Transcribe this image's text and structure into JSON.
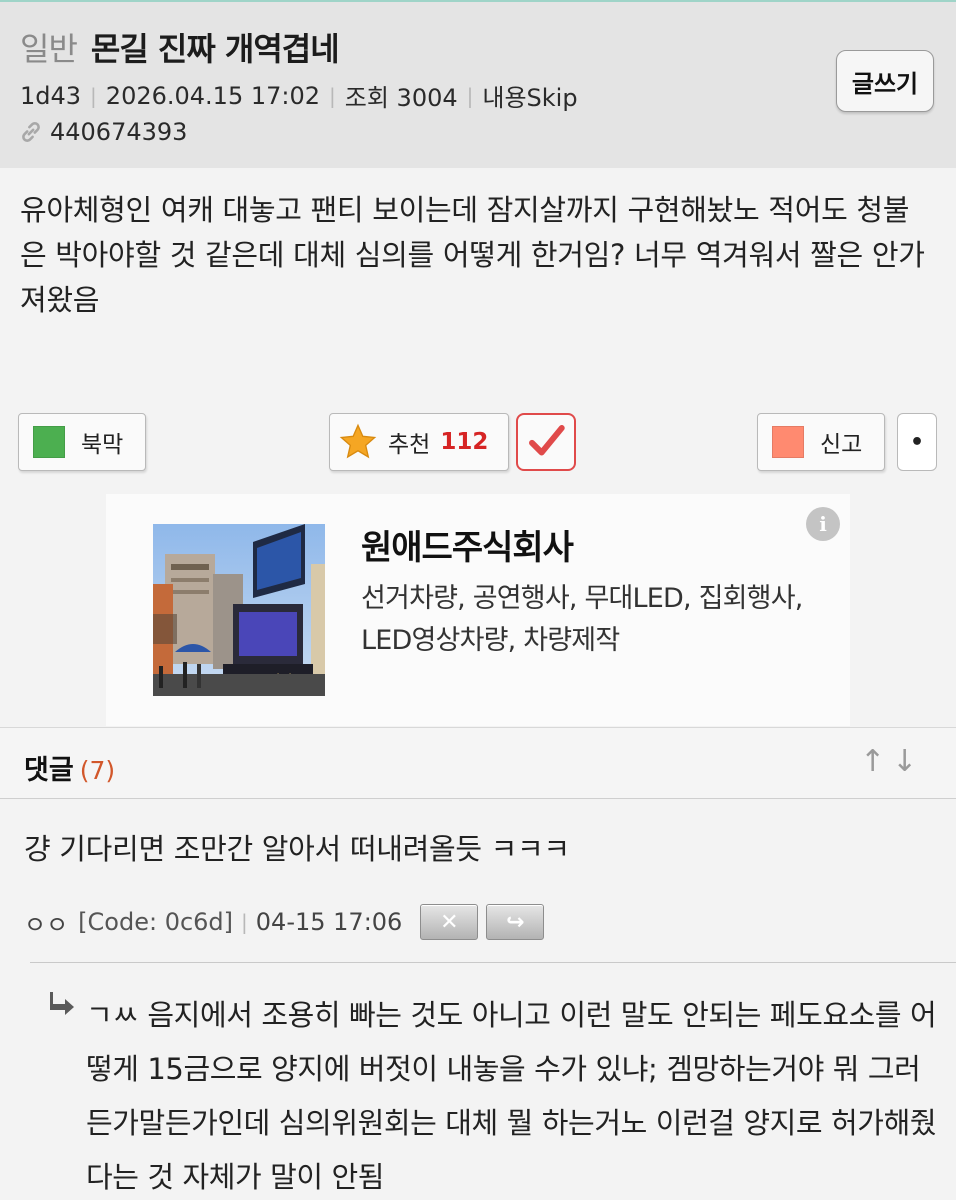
{
  "post": {
    "category": "일반",
    "title": "몬길 진짜 개역겹네",
    "author": "1d43",
    "datetime": "2026.04.15 17:02",
    "views": "조회 3004",
    "skip": "내용Skip",
    "post_number": "440674393",
    "write_button": "글쓰기",
    "body": "유아체형인 여캐 대놓고 팬티 보이는데 잠지살까지 구현해놨노 적어도 청불은 박아야할 것 같은데 대체 심의를 어떻게 한거임? 너무 역겨워서 짤은 안가져왔음"
  },
  "actions": {
    "bookmark_label": "북막",
    "recommend_label": "추천",
    "recommend_count": "112",
    "report_label": "신고",
    "more_label": "•",
    "colors": {
      "bookmark": "#4caf50",
      "report": "#ff8a70",
      "star": "#f5a623",
      "check": "#e04a4a"
    }
  },
  "ad": {
    "name": "원애드주식회사",
    "description": "선거차량, 공연행사, 무대LED, 집회행사, LED영상차량, 차량제작",
    "info_icon": "info-icon"
  },
  "comments": {
    "title": "댓글",
    "count": "(7)",
    "up_arrow": "↑",
    "down_arrow": "↓",
    "items": [
      {
        "text": "걍 기다리면 조만간 알아서 떠내려올듯 ㅋㅋㅋ",
        "author": "ㅇㅇ",
        "code": "[Code: 0c6d]",
        "time": "04-15 17:06",
        "delete_icon": "✕",
        "reply_icon": "↪"
      }
    ],
    "replies": [
      {
        "text": "ㄱㅆ 음지에서 조용히 빠는 것도 아니고 이런 말도 안되는 페도요소를 어떻게 15금으로 양지에 버젓이 내놓을 수가 있냐; 겜망하는거야 뭐 그러든가말든가인데 심의위원회는 대체 뭘 하는거노 이런걸 양지로 허가해줬다는 것 자체가 말이 안됨"
      }
    ]
  }
}
